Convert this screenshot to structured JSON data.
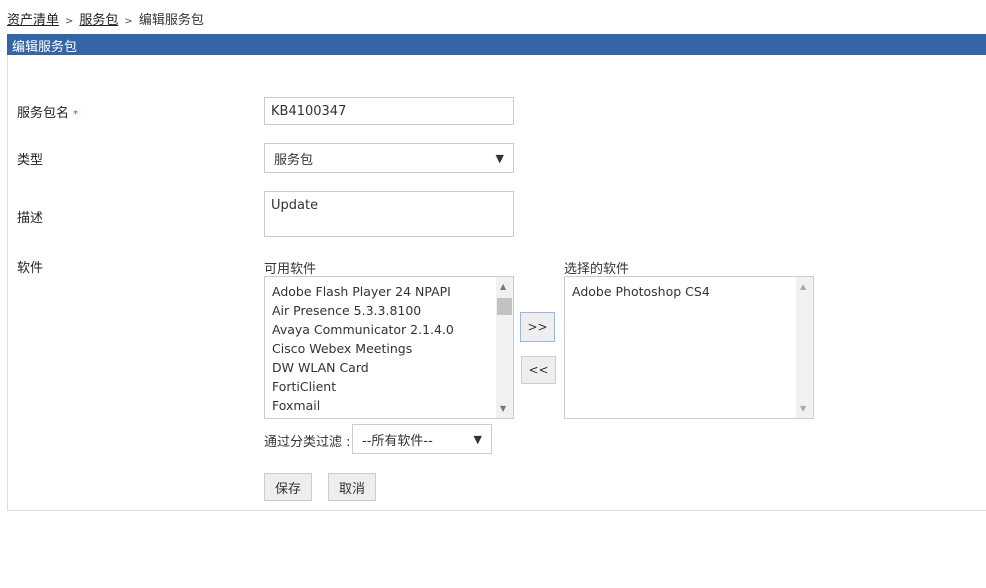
{
  "breadcrumb": {
    "items": [
      "资产清单",
      "服务包"
    ],
    "current": "编辑服务包",
    "separator": ">"
  },
  "panel": {
    "title": "编辑服务包"
  },
  "form": {
    "name_label": "服务包名",
    "required_mark": "*",
    "name_value": "KB4100347",
    "type_label": "类型",
    "type_value": "服务包",
    "desc_label": "描述",
    "desc_value": "Update",
    "software_label": "软件",
    "available_label": "可用软件",
    "available_items": [
      "Adobe Flash Player 24 NPAPI",
      "Air Presence 5.3.3.8100",
      "Avaya Communicator 2.1.4.0",
      "Cisco Webex Meetings",
      "DW WLAN Card",
      "FortiClient",
      "Foxmail"
    ],
    "selected_label": "选择的软件",
    "selected_items": [
      "Adobe Photoshop CS4"
    ],
    "add_button": ">>",
    "remove_button": "<<",
    "filter_label": "通过分类过滤 :",
    "filter_value": "--所有软件--",
    "save_button": "保存",
    "cancel_button": "取消"
  }
}
